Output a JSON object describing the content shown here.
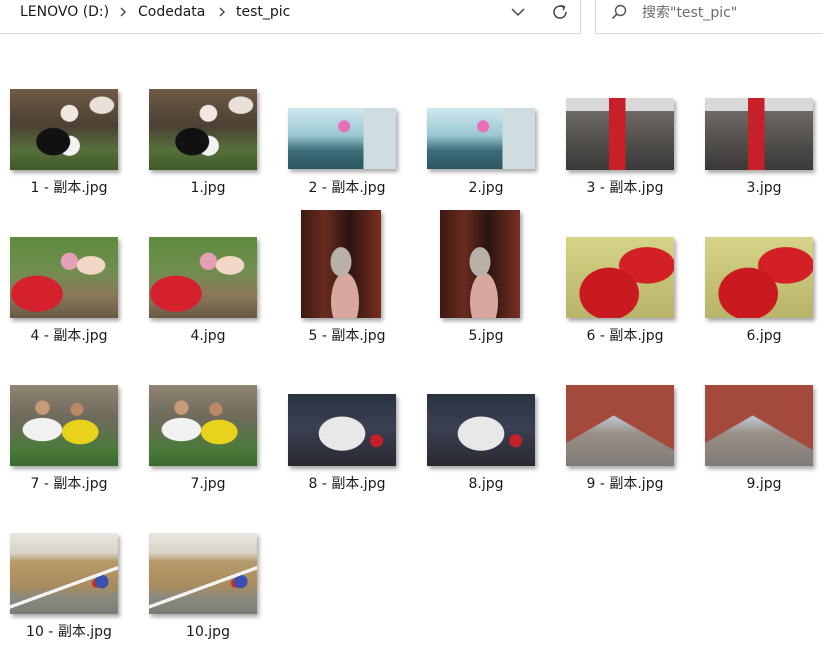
{
  "address_bar": {
    "crumbs": [
      "LENOVO (D:)",
      "Codedata",
      "test_pic"
    ]
  },
  "search": {
    "placeholder": "搜索\"test_pic\""
  },
  "icons": {
    "separator": "chevron-right-icon",
    "dropdown": "chevron-down-icon",
    "refresh": "refresh-icon",
    "search": "search-icon"
  },
  "files": [
    {
      "name": "1 - 副本.jpg",
      "thumb": "cows"
    },
    {
      "name": "1.jpg",
      "thumb": "cows"
    },
    {
      "name": "2 - 副本.jpg",
      "thumb": "pink"
    },
    {
      "name": "2.jpg",
      "thumb": "pink"
    },
    {
      "name": "3 - 副本.jpg",
      "thumb": "shop"
    },
    {
      "name": "3.jpg",
      "thumb": "shop"
    },
    {
      "name": "4 - 副本.jpg",
      "thumb": "bike"
    },
    {
      "name": "4.jpg",
      "thumb": "bike"
    },
    {
      "name": "5 - 副本.jpg",
      "thumb": "girl"
    },
    {
      "name": "5.jpg",
      "thumb": "girl"
    },
    {
      "name": "6 - 副本.jpg",
      "thumb": "ferrari"
    },
    {
      "name": "6.jpg",
      "thumb": "ferrari"
    },
    {
      "name": "7 - 副本.jpg",
      "thumb": "soccer"
    },
    {
      "name": "7.jpg",
      "thumb": "soccer"
    },
    {
      "name": "8 - 副本.jpg",
      "thumb": "racecar"
    },
    {
      "name": "8.jpg",
      "thumb": "racecar"
    },
    {
      "name": "9 - 副本.jpg",
      "thumb": "street"
    },
    {
      "name": "9.jpg",
      "thumb": "street"
    },
    {
      "name": "10 - 副本.jpg",
      "thumb": "track"
    },
    {
      "name": "10.jpg",
      "thumb": "track"
    }
  ]
}
